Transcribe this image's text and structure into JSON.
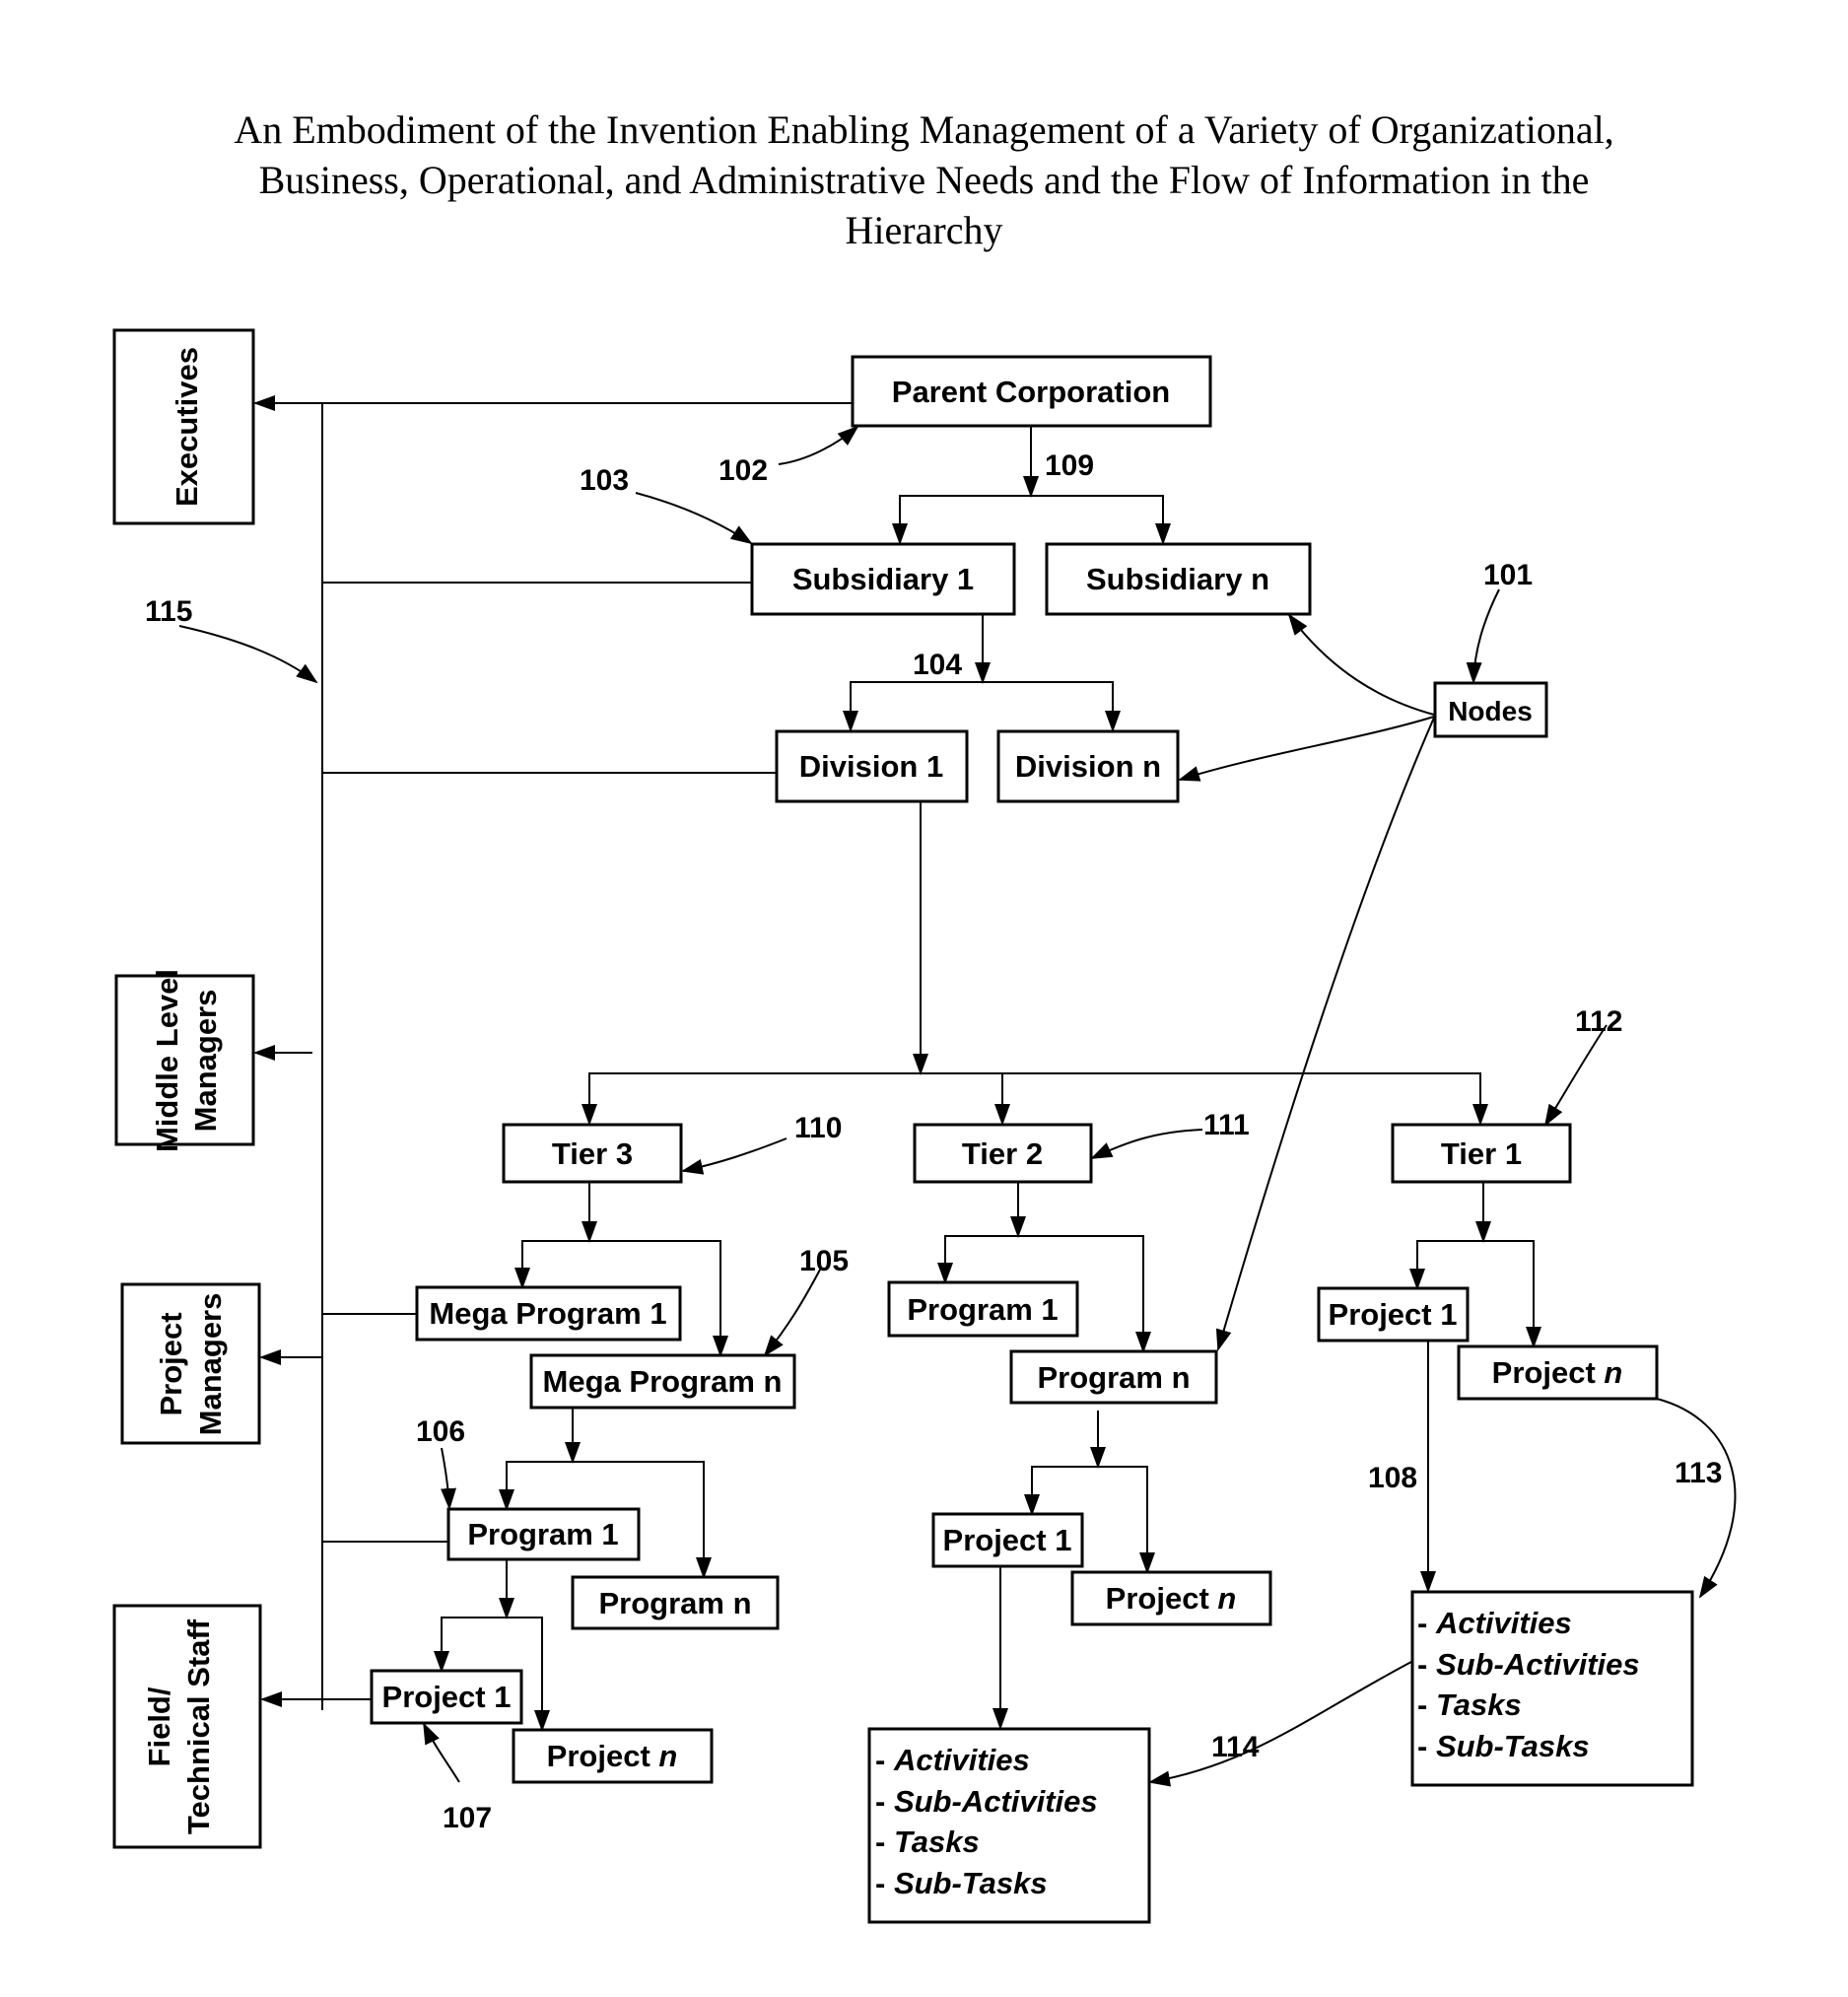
{
  "title": {
    "lines": [
      "An Embodiment of the Invention Enabling Management of a Variety of Organizational,",
      "Business, Operational, and Administrative Needs and the Flow of Information in the",
      "Hierarchy"
    ]
  },
  "roles": {
    "executives": "Executives",
    "middle_line1": "Middle Level",
    "middle_line2": "Managers",
    "pm_line1": "Project",
    "pm_line2": "Managers",
    "field_line1": "Field/",
    "field_line2": "Technical Staff"
  },
  "nodes": {
    "parent": "Parent Corporation",
    "subsidiary_1": "Subsidiary 1",
    "subsidiary_n": "Subsidiary n",
    "division_1": "Division 1",
    "division_n": "Division n",
    "nodes": "Nodes",
    "tier_3": "Tier 3",
    "tier_2": "Tier 2",
    "tier_1": "Tier 1",
    "mega_program_1": "Mega Program 1",
    "mega_program_n": "Mega Program n",
    "t3_program_1": "Program 1",
    "t3_program_n": "Program n",
    "t3_project_1": "Project 1",
    "t3_project_n_prefix": "Project ",
    "t3_project_n_suffix": "n",
    "t2_program_1": "Program 1",
    "t2_program_n": "Program n",
    "t2_project_1": "Project 1",
    "t2_project_n_prefix": "Project ",
    "t2_project_n_suffix": "n",
    "t1_project_1": "Project 1",
    "t1_project_n_prefix": "Project ",
    "t1_project_n_suffix": "n"
  },
  "work_items": [
    {
      "dash": "- ",
      "label": "Activities"
    },
    {
      "dash": "- ",
      "label": "Sub-Activities"
    },
    {
      "dash": "- ",
      "label": "Tasks"
    },
    {
      "dash": "- ",
      "label": "Sub-Tasks"
    }
  ],
  "refs": {
    "r101": "101",
    "r102": "102",
    "r103": "103",
    "r104": "104",
    "r105": "105",
    "r106": "106",
    "r107": "107",
    "r108": "108",
    "r109": "109",
    "r110": "110",
    "r111": "111",
    "r112": "112",
    "r113": "113",
    "r114": "114",
    "r115": "115"
  }
}
